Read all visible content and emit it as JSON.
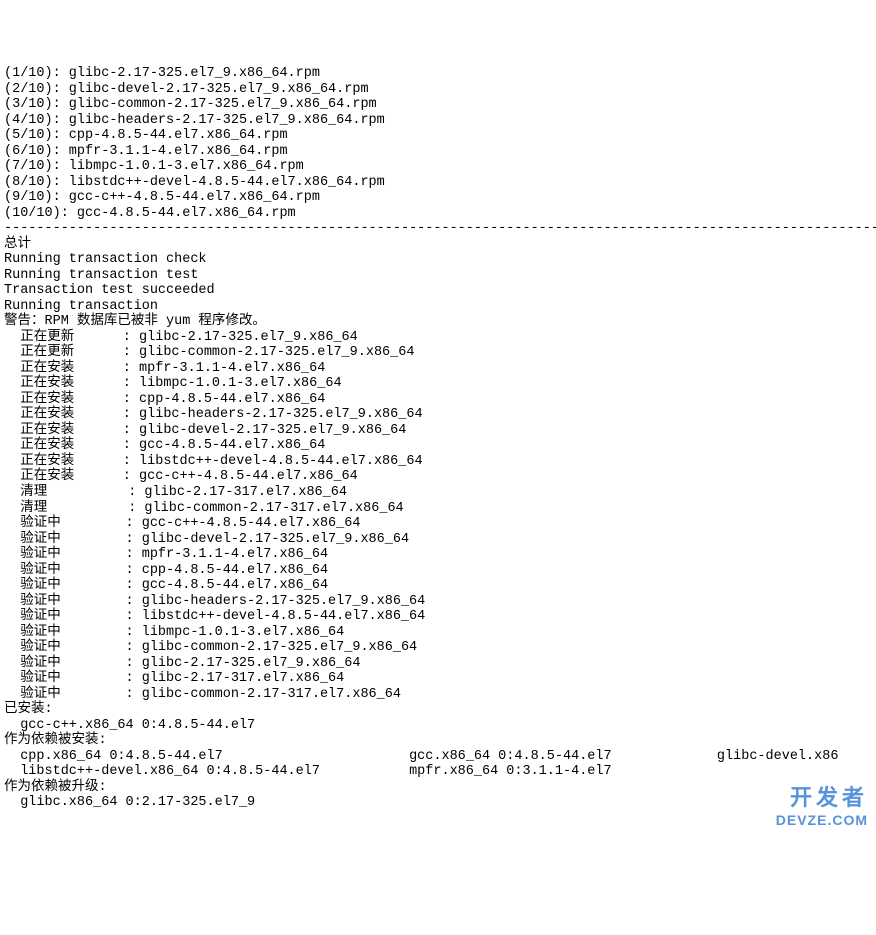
{
  "downloads": [
    "(1/10): glibc-2.17-325.el7_9.x86_64.rpm",
    "(2/10): glibc-devel-2.17-325.el7_9.x86_64.rpm",
    "(3/10): glibc-common-2.17-325.el7_9.x86_64.rpm",
    "(4/10): glibc-headers-2.17-325.el7_9.x86_64.rpm",
    "(5/10): cpp-4.8.5-44.el7.x86_64.rpm",
    "(6/10): mpfr-3.1.1-4.el7.x86_64.rpm",
    "(7/10): libmpc-1.0.1-3.el7.x86_64.rpm",
    "(8/10): libstdc++-devel-4.8.5-44.el7.x86_64.rpm",
    "(9/10): gcc-c++-4.8.5-44.el7.x86_64.rpm",
    "(10/10): gcc-4.8.5-44.el7.x86_64.rpm"
  ],
  "separator": "-------------------------------------------------------------------------------------------------------------",
  "total_label": "总计",
  "transaction_msgs": [
    "Running transaction check",
    "Running transaction test",
    "Transaction test succeeded",
    "Running transaction"
  ],
  "warning": "警告：RPM 数据库已被非 yum 程序修改。",
  "actions": [
    {
      "act": "正在更新",
      "pkg": "glibc-2.17-325.el7_9.x86_64"
    },
    {
      "act": "正在更新",
      "pkg": "glibc-common-2.17-325.el7_9.x86_64"
    },
    {
      "act": "正在安装",
      "pkg": "mpfr-3.1.1-4.el7.x86_64"
    },
    {
      "act": "正在安装",
      "pkg": "libmpc-1.0.1-3.el7.x86_64"
    },
    {
      "act": "正在安装",
      "pkg": "cpp-4.8.5-44.el7.x86_64"
    },
    {
      "act": "正在安装",
      "pkg": "glibc-headers-2.17-325.el7_9.x86_64"
    },
    {
      "act": "正在安装",
      "pkg": "glibc-devel-2.17-325.el7_9.x86_64"
    },
    {
      "act": "正在安装",
      "pkg": "gcc-4.8.5-44.el7.x86_64"
    },
    {
      "act": "正在安装",
      "pkg": "libstdc++-devel-4.8.5-44.el7.x86_64"
    },
    {
      "act": "正在安装",
      "pkg": "gcc-c++-4.8.5-44.el7.x86_64"
    },
    {
      "act": "清理",
      "pkg": "glibc-2.17-317.el7.x86_64"
    },
    {
      "act": "清理",
      "pkg": "glibc-common-2.17-317.el7.x86_64"
    },
    {
      "act": "验证中",
      "pkg": "gcc-c++-4.8.5-44.el7.x86_64"
    },
    {
      "act": "验证中",
      "pkg": "glibc-devel-2.17-325.el7_9.x86_64"
    },
    {
      "act": "验证中",
      "pkg": "mpfr-3.1.1-4.el7.x86_64"
    },
    {
      "act": "验证中",
      "pkg": "cpp-4.8.5-44.el7.x86_64"
    },
    {
      "act": "验证中",
      "pkg": "gcc-4.8.5-44.el7.x86_64"
    },
    {
      "act": "验证中",
      "pkg": "glibc-headers-2.17-325.el7_9.x86_64"
    },
    {
      "act": "验证中",
      "pkg": "libstdc++-devel-4.8.5-44.el7.x86_64"
    },
    {
      "act": "验证中",
      "pkg": "libmpc-1.0.1-3.el7.x86_64"
    },
    {
      "act": "验证中",
      "pkg": "glibc-common-2.17-325.el7_9.x86_64"
    },
    {
      "act": "验证中",
      "pkg": "glibc-2.17-325.el7_9.x86_64"
    },
    {
      "act": "验证中",
      "pkg": "glibc-2.17-317.el7.x86_64"
    },
    {
      "act": "验证中",
      "pkg": "glibc-common-2.17-317.el7.x86_64"
    }
  ],
  "installed_header": "已安装:",
  "installed": [
    "gcc-c++.x86_64 0:4.8.5-44.el7"
  ],
  "dep_installed_header": "作为依赖被安装:",
  "dep_installed_rows": [
    [
      "cpp.x86_64 0:4.8.5-44.el7",
      "gcc.x86_64 0:4.8.5-44.el7",
      "glibc-devel.x86"
    ],
    [
      "libstdc++-devel.x86_64 0:4.8.5-44.el7",
      "mpfr.x86_64 0:3.1.1-4.el7",
      ""
    ]
  ],
  "dep_upgraded_header": "作为依赖被升级:",
  "dep_upgraded": [
    "glibc.x86_64 0:2.17-325.el7_9"
  ],
  "watermark": {
    "main": "开发者",
    "sub": "DEVZE.COM"
  }
}
